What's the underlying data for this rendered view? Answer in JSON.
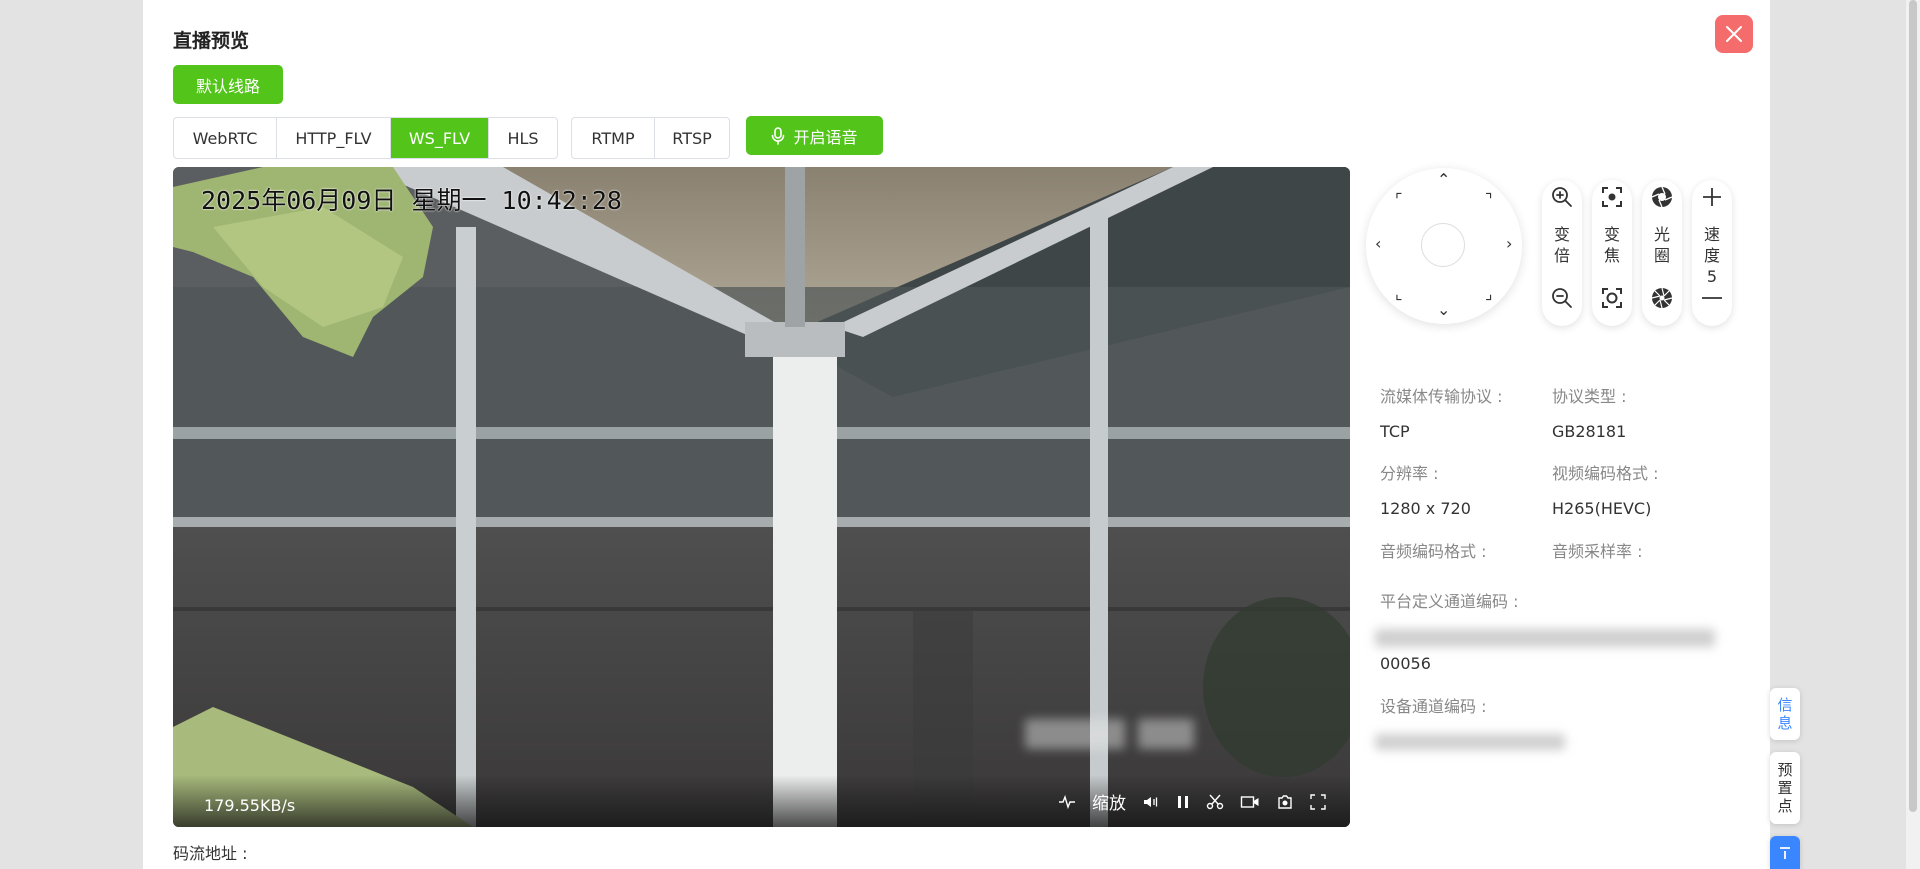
{
  "dialog": {
    "title": "直播预览"
  },
  "route_button": "默认线路",
  "protocol_tabs": [
    {
      "label": "WebRTC",
      "active": false
    },
    {
      "label": "HTTP_FLV",
      "active": false
    },
    {
      "label": "WS_FLV",
      "active": true
    },
    {
      "label": "HLS",
      "active": false
    }
  ],
  "push_tabs": [
    {
      "label": "RTMP"
    },
    {
      "label": "RTSP"
    }
  ],
  "voice_button": {
    "label": "开启语音",
    "icon": "microphone-icon"
  },
  "player": {
    "osd_time": "2025年06月09日 星期一 10:42:28",
    "bitrate": "179.55KB/s",
    "zoom_label": "缩放",
    "controls": [
      "waveform-icon",
      "zoom-text",
      "volume-icon",
      "pause-icon",
      "scissors-icon",
      "record-icon",
      "snapshot-icon",
      "fullscreen-icon"
    ]
  },
  "stream_address_label": "码流地址 :",
  "ptz": {
    "zoom": {
      "label": "变倍",
      "top_icon": "zoom-in-icon",
      "bottom_icon": "zoom-out-icon"
    },
    "focus": {
      "label": "变焦",
      "top_icon": "focus-near-icon",
      "bottom_icon": "focus-far-icon"
    },
    "iris": {
      "label": "光圈",
      "top_icon": "iris-open-icon",
      "bottom_icon": "iris-close-icon"
    },
    "speed": {
      "label": "速度",
      "value": "5",
      "top_icon": "plus-icon",
      "bottom_icon": "minus-icon"
    }
  },
  "info": {
    "transport_label": "流媒体传输协议 :",
    "transport_value": "TCP",
    "protocol_label": "协议类型 :",
    "protocol_value": "GB28181",
    "resolution_label": "分辨率 :",
    "resolution_value": "1280 x 720",
    "video_codec_label": "视频编码格式 :",
    "video_codec_value": "H265(HEVC)",
    "audio_codec_label": "音频编码格式 :",
    "audio_rate_label": "音频采样率 :",
    "platform_channel_label": "平台定义通道编码 :",
    "platform_channel_value_tail": "00056",
    "device_channel_label": "设备通道编码 :"
  },
  "side_tabs": [
    {
      "label": "信息",
      "color": "#3a86ff"
    },
    {
      "label": "预置点",
      "color": "#333333"
    }
  ],
  "colors": {
    "accent": "#52c41a",
    "close": "#f56c6c",
    "link_blue": "#3a86ff"
  }
}
